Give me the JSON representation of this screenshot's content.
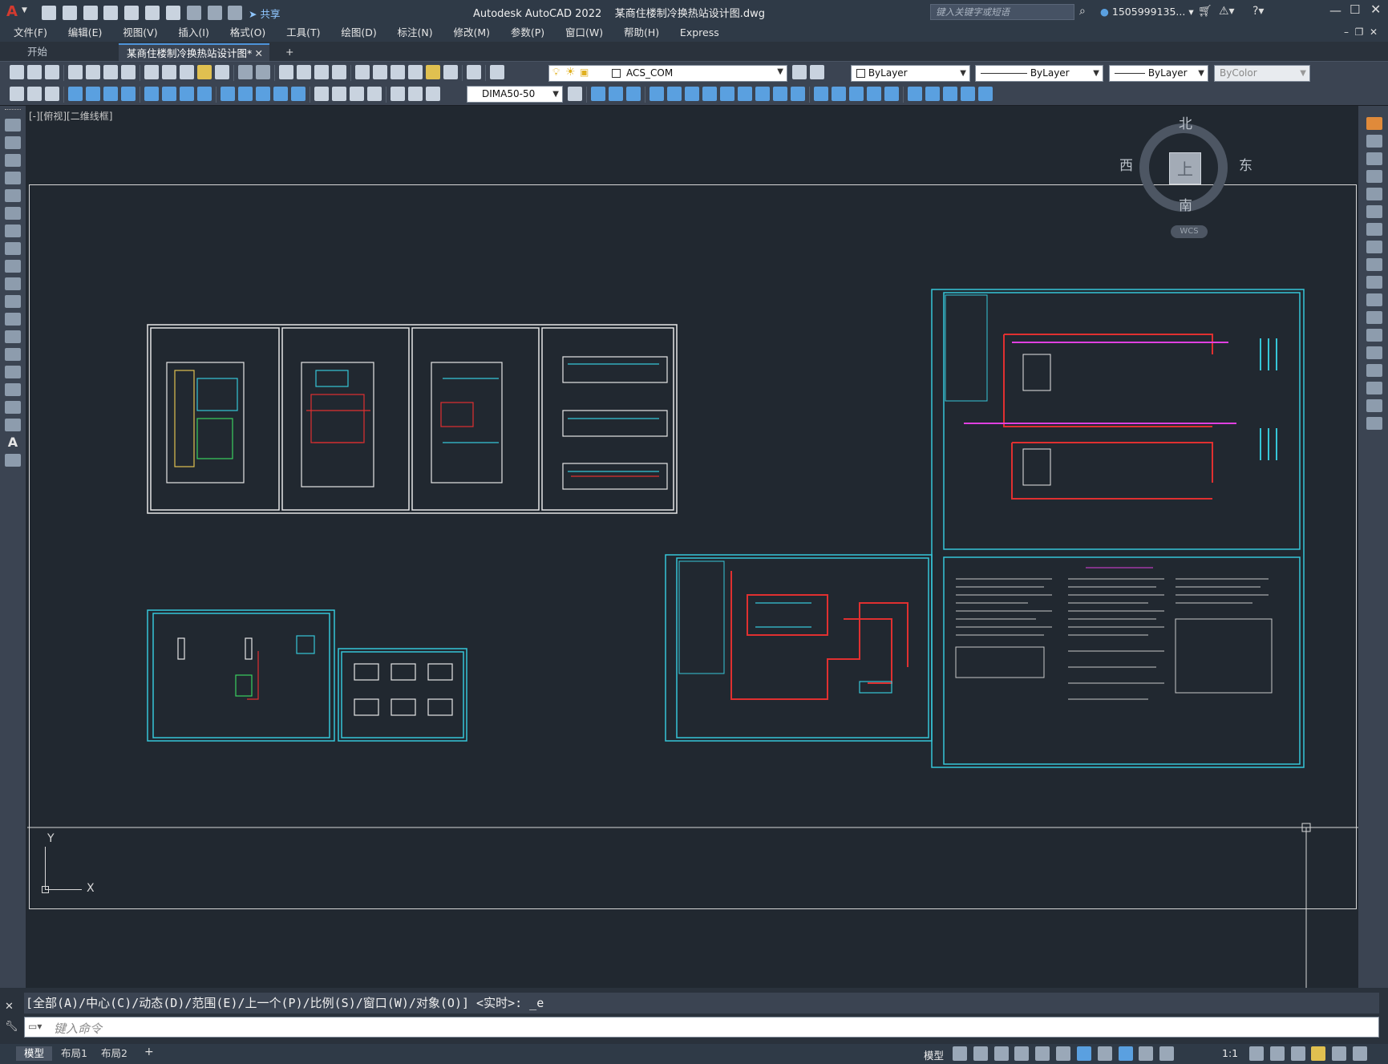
{
  "app": {
    "title": "Autodesk AutoCAD 2022",
    "document": "某商住楼制冷换热站设计图.dwg",
    "share_label": "共享",
    "search_placeholder": "键入关键字或短语",
    "user": "1505999135...",
    "accent_color": "#d43a2f"
  },
  "menu": [
    "文件(F)",
    "编辑(E)",
    "视图(V)",
    "插入(I)",
    "格式(O)",
    "工具(T)",
    "绘图(D)",
    "标注(N)",
    "修改(M)",
    "参数(P)",
    "窗口(W)",
    "帮助(H)",
    "Express"
  ],
  "tabs": {
    "start": "开始",
    "active": "某商住楼制冷换热站设计图*",
    "add": "+"
  },
  "toolbar": {
    "layer": "ACS_COM",
    "color": "ByLayer",
    "linetype": "ByLayer",
    "lineweight": "ByLayer",
    "plotstyle": "ByColor",
    "dimstyle": "DIMA50-50"
  },
  "viewport": {
    "label": "[-][俯视][二维线框]",
    "viewcube": {
      "north": "北",
      "south": "南",
      "east": "东",
      "west": "西",
      "top": "上",
      "wcs": "WCS"
    },
    "ucs_x": "X",
    "ucs_y": "Y"
  },
  "command": {
    "history": "[全部(A)/中心(C)/动态(D)/范围(E)/上一个(P)/比例(S)/窗口(W)/对象(O)] <实时>: _e",
    "placeholder": "键入命令"
  },
  "status": {
    "tabs": [
      "模型",
      "布局1",
      "布局2"
    ],
    "model_label": "模型",
    "scale": "1:1"
  }
}
